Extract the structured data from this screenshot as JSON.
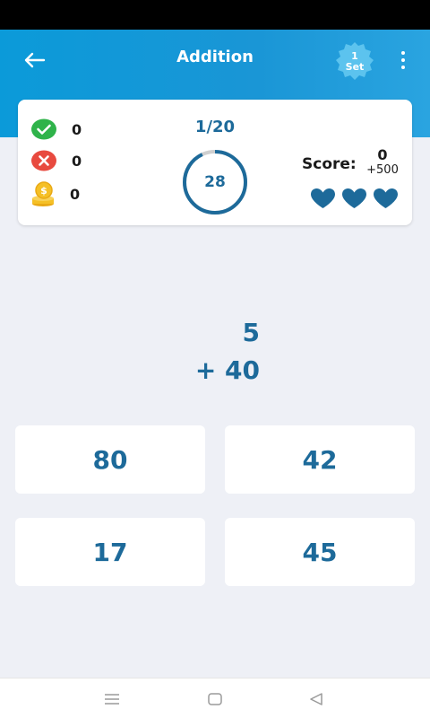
{
  "header": {
    "title": "Addition",
    "set_badge": {
      "line1": "1",
      "line2": "Set"
    }
  },
  "stats": {
    "correct": "0",
    "wrong": "0",
    "coins": "0",
    "progress": "1/20",
    "timer": "28",
    "timer_fraction": 0.93,
    "score_label": "Score:",
    "score": "0",
    "score_bonus": "+500",
    "lives": 3
  },
  "question": {
    "top": "5",
    "bottom": "+ 40"
  },
  "answers": [
    "80",
    "42",
    "17",
    "45"
  ],
  "colors": {
    "accent": "#1d6a9a",
    "header": "#1a96d6",
    "correct": "#2fb34a",
    "wrong": "#e84a3f",
    "coin": "#f5c026",
    "heart": "#1d6a9a"
  }
}
